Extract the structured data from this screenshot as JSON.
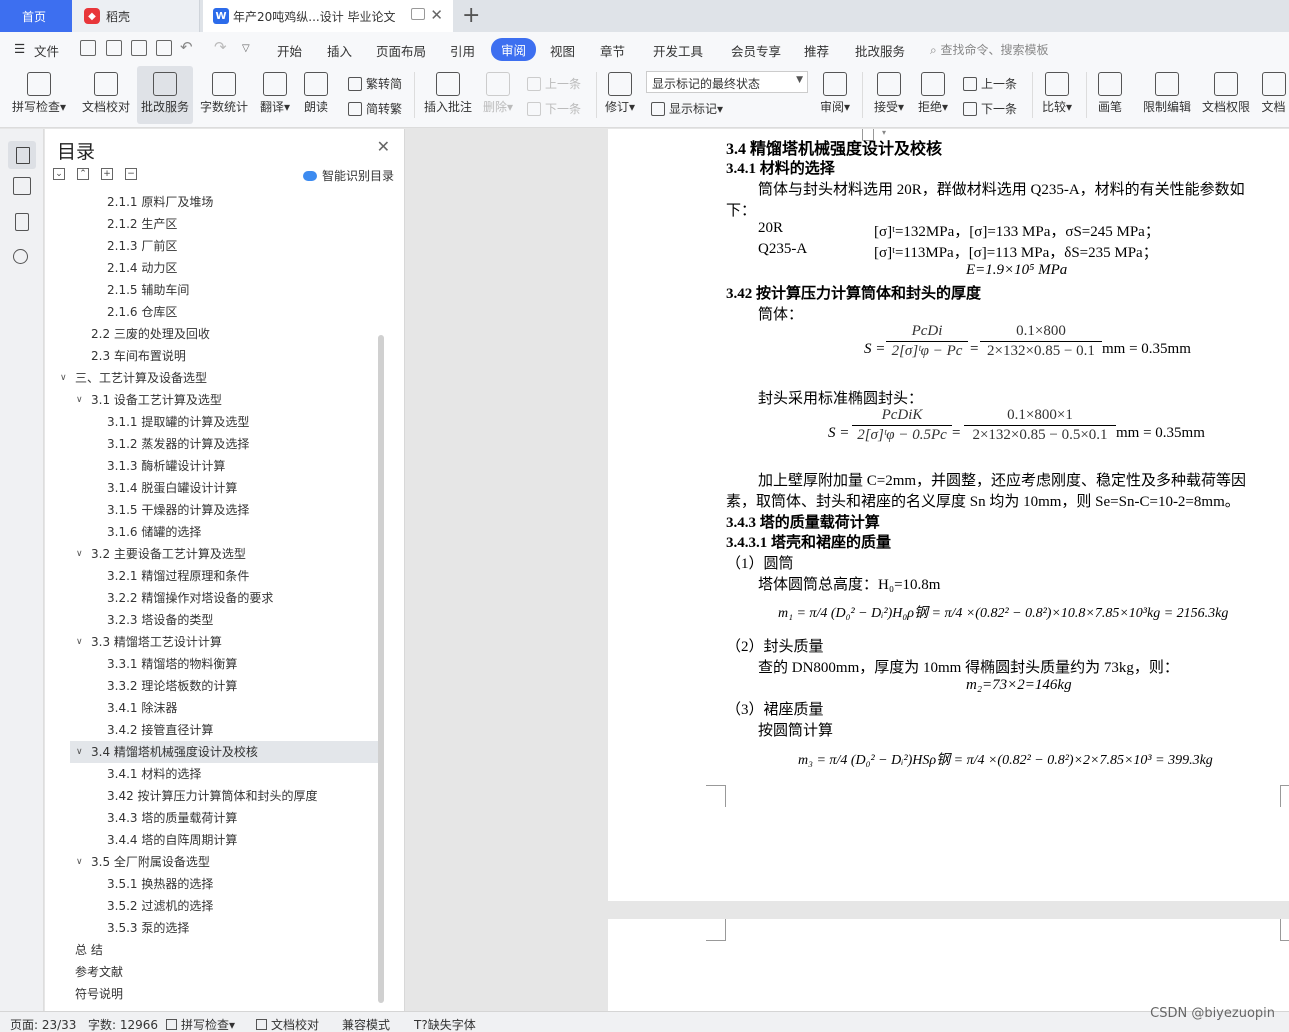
{
  "tabs": {
    "home": "首页",
    "daoke": "稻壳",
    "doc": "年产20吨鸡纵...设计 毕业论文",
    "add": "+"
  },
  "menubar": {
    "file": "文件",
    "items": [
      "开始",
      "插入",
      "页面布局",
      "引用",
      "审阅",
      "视图",
      "章节",
      "开发工具",
      "会员专享",
      "推荐",
      "批改服务"
    ],
    "active": "审阅",
    "search": "查找命令、搜索模板"
  },
  "ribbon": {
    "spell": "拼写检查",
    "doc_check": "文档校对",
    "correction": "批改服务",
    "word_count": "字数统计",
    "translate": "翻译",
    "read": "朗读",
    "trad": "繁转简",
    "simp": "简转繁",
    "insert_comment": "插入批注",
    "delete": "删除",
    "prev": "上一条",
    "next": "下一条",
    "revise": "修订",
    "mark_state": "显示标记的最终状态",
    "show_mark": "显示标记",
    "review": "审阅",
    "accept": "接受",
    "reject": "拒绝",
    "prev2": "上一条",
    "next2": "下一条",
    "compare": "比较",
    "pen": "画笔",
    "restrict": "限制编辑",
    "permission": "文档权限",
    "doc_more": "文档"
  },
  "toc": {
    "title": "目录",
    "smart": "智能识别目录",
    "items": [
      {
        "label": "2.1.1  原料厂及堆场",
        "level": 3
      },
      {
        "label": "2.1.2  生产区",
        "level": 3
      },
      {
        "label": "2.1.3  厂前区",
        "level": 3
      },
      {
        "label": "2.1.4  动力区",
        "level": 3
      },
      {
        "label": "2.1.5  辅助车间",
        "level": 3
      },
      {
        "label": "2.1.6  仓库区",
        "level": 3
      },
      {
        "label": "2.2  三废的处理及回收",
        "level": 2
      },
      {
        "label": "2.3  车间布置说明",
        "level": 2
      },
      {
        "label": "三、工艺计算及设备选型",
        "level": 1
      },
      {
        "label": "3.1  设备工艺计算及选型",
        "level": 2
      },
      {
        "label": "3.1.1  提取罐的计算及选型",
        "level": 3
      },
      {
        "label": "3.1.2  蒸发器的计算及选择",
        "level": 3
      },
      {
        "label": "3.1.3  酶析罐设计计算",
        "level": 3
      },
      {
        "label": "3.1.4  脱蛋白罐设计计算",
        "level": 3
      },
      {
        "label": "3.1.5  干燥器的计算及选择",
        "level": 3
      },
      {
        "label": "3.1.6  储罐的选择",
        "level": 3
      },
      {
        "label": "3.2  主要设备工艺计算及选型",
        "level": 2
      },
      {
        "label": "3.2.1  精馏过程原理和条件",
        "level": 3
      },
      {
        "label": "3.2.2  精馏操作对塔设备的要求",
        "level": 3
      },
      {
        "label": "3.2.3  塔设备的类型",
        "level": 3
      },
      {
        "label": "3.3  精馏塔工艺设计计算",
        "level": 2
      },
      {
        "label": "3.3.1  精馏塔的物料衡算",
        "level": 3
      },
      {
        "label": "3.3.2  理论塔板数的计算",
        "level": 3
      },
      {
        "label": "3.4.1  除沫器",
        "level": 3
      },
      {
        "label": "3.4.2  接管直径计算",
        "level": 3
      },
      {
        "label": "3.4  精馏塔机械强度设计及校核",
        "level": 2
      },
      {
        "label": "3.4.1  材料的选择",
        "level": 3
      },
      {
        "label": "3.42  按计算压力计算筒体和封头的厚度",
        "level": 3
      },
      {
        "label": "3.4.3  塔的质量载荷计算",
        "level": 3
      },
      {
        "label": "3.4.4  塔的自阵周期计算",
        "level": 3
      },
      {
        "label": "3.5  全厂附属设备选型",
        "level": 2
      },
      {
        "label": "3.5.1  换热器的选择",
        "level": 3
      },
      {
        "label": "3.5.2  过滤机的选择",
        "level": 3
      },
      {
        "label": "3.5.3  泵的选择",
        "level": 3
      },
      {
        "label": "总    结",
        "level": 0
      },
      {
        "label": "参考文献",
        "level": 0
      },
      {
        "label": "符号说明",
        "level": 0
      }
    ]
  },
  "doc": {
    "h1": "3.4  精馏塔机械强度设计及校核",
    "h2a": "3.4.1  材料的选择",
    "p1a": "筒体与封头材料选用 20R，群做材料选用 Q235-A，材料的有关性能参数如",
    "p1b": "下：",
    "m1_name": "20R",
    "m1_vals": "[σ]ᵗ=132MPa，[σ]=133 MPa，σS=245 MPa；",
    "m2_name": "Q235-A",
    "m2_vals": "[σ]ᵗ=113MPa，[σ]=113 MPa，δS=235 MPa；",
    "e_val": "E=1.9×10⁵ MPa",
    "h2b": "3.42  按计算压力计算筒体和封头的厚度",
    "shell": "筒体：",
    "eq1_lhs": "S =",
    "eq1_n1": "PcDi",
    "eq1_d1": "2[σ]ᵗφ − Pc",
    "eq1_n2": "0.1×800",
    "eq1_d2": "2×132×0.85 − 0.1",
    "eq1_rhs": "mm = 0.35mm",
    "head_txt": "封头采用标准椭圆封头：",
    "eq2_lhs": "S =",
    "eq2_n1": "PcDiK",
    "eq2_d1": "2[σ]ᵗφ − 0.5Pc",
    "eq2_n2": "0.1×800×1",
    "eq2_d2": "2×132×0.85 − 0.5×0.1",
    "eq2_rhs": "mm = 0.35mm",
    "p2a": "加上壁厚附加量 C=2mm，并圆整，还应考虑刚度、稳定性及多种载荷等因",
    "p2b": "素，取筒体、封头和裙座的名义厚度 Sn 均为 10mm，则 Se=Sn-C=10-2=8mm。",
    "h2c": "3.4.3  塔的质量载荷计算",
    "h3a": "3.4.3.1  塔壳和裙座的质量",
    "c1": "（1）圆筒",
    "c1_txt": "塔体圆筒总高度：H₀=10.8m",
    "eq3": "m₁ = π/4 (D₀² − Dᵢ²)H₀ρ钢 = π/4 ×(0.82² − 0.8²)×10.8×7.85×10³kg = 2156.3kg",
    "c2": "（2）封头质量",
    "c2_txt": "查的 DN800mm，厚度为 10mm 得椭圆封头质量约为 73kg，则：",
    "c2_eq": "m₂=73×2=146kg",
    "c3": "（3）裙座质量",
    "c3_txt": "按圆筒计算",
    "eq4": "m₃ = π/4 (D₀² − Dᵢ²)HSρ钢 = π/4 ×(0.82² − 0.8²)×2×7.85×10³ = 399.3kg"
  },
  "status": {
    "page": "页面: 23/33",
    "words": "字数: 12966",
    "spell": "拼写检查",
    "proof": "文档校对",
    "compat": "兼容模式",
    "font_missing": "缺失字体",
    "watermark": "CSDN @biyezuopin"
  }
}
